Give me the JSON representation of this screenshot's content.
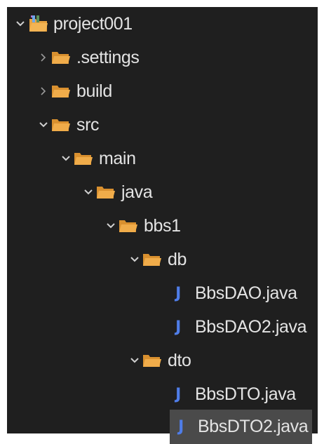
{
  "tree": {
    "project": {
      "label": "project001",
      "expanded": true
    },
    "items": [
      {
        "label": ".settings",
        "type": "folder",
        "expanded": false
      },
      {
        "label": "build",
        "type": "folder",
        "expanded": false
      },
      {
        "label": "src",
        "type": "folder",
        "expanded": true
      },
      {
        "label": "main",
        "type": "folder",
        "expanded": true
      },
      {
        "label": "java",
        "type": "folder",
        "expanded": true
      },
      {
        "label": "bbs1",
        "type": "folder",
        "expanded": true
      },
      {
        "label": "db",
        "type": "folder",
        "expanded": true
      },
      {
        "label": "BbsDAO.java",
        "type": "java-file"
      },
      {
        "label": "BbsDAO2.java",
        "type": "java-file"
      },
      {
        "label": "dto",
        "type": "folder",
        "expanded": true
      },
      {
        "label": "BbsDTO.java",
        "type": "java-file"
      },
      {
        "label": "BbsDTO2.java",
        "type": "java-file",
        "selected": true
      }
    ],
    "java_icon_glyph": "J"
  },
  "colors": {
    "background": "#1f1f1f",
    "text": "#e3e3e3",
    "folder": "#e8a23f",
    "java_icon": "#4f7de8",
    "selection": "#4a4a4a"
  }
}
